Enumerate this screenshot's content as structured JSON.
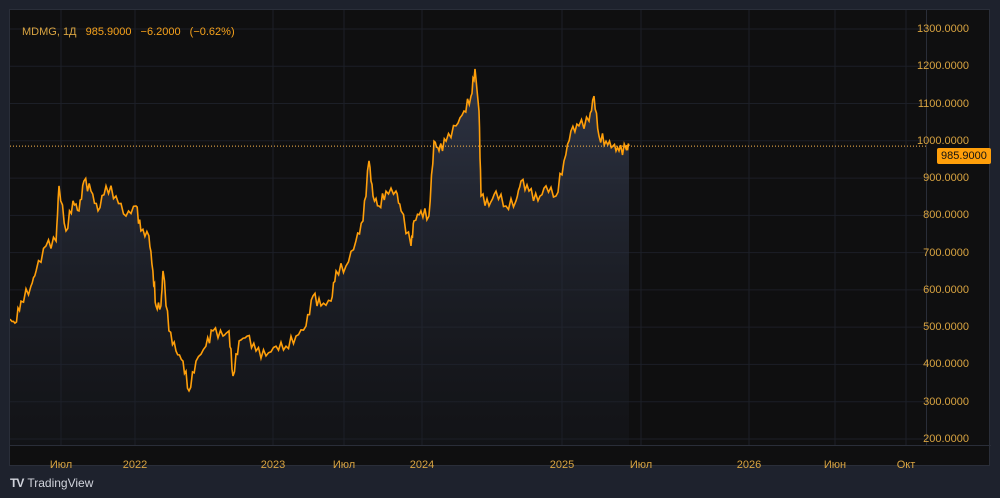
{
  "legend": {
    "symbol": "MDMG, 1Д",
    "price": "985.9000",
    "change": "−6.2000",
    "change_pct": "(−0.62%)"
  },
  "price_tag": "985.9000",
  "brand": "TradingView",
  "colors": {
    "line": "#ff9f0a",
    "text": "#d9a441"
  },
  "chart_data": {
    "type": "area",
    "title": "MDMG, 1Д",
    "ylim": [
      200,
      1300
    ],
    "y_ticks": [
      "1300.0000",
      "1200.0000",
      "1100.0000",
      "1000.0000",
      "900.0000",
      "800.0000",
      "700.0000",
      "600.0000",
      "500.0000",
      "400.0000",
      "300.0000",
      "200.0000"
    ],
    "x_ticks": [
      "Июл",
      "2022",
      "2023",
      "Июл",
      "2024",
      "2025",
      "Июл",
      "2026",
      "Июн",
      "Окт"
    ],
    "last_price": 985.9,
    "series": [
      {
        "name": "MDMG",
        "x": [
          2021.087,
          2021.13,
          2021.174,
          2021.246,
          2021.283,
          2021.355,
          2021.428,
          2021.449,
          2021.5,
          2021.551,
          2021.594,
          2021.63,
          2021.681,
          2021.732,
          2021.79,
          2021.862,
          2021.935,
          2022.007,
          2022.043,
          2022.101,
          2022.13,
          2022.152,
          2022.188,
          2022.203,
          2022.246,
          2022.297,
          2022.348,
          2022.391,
          2022.442,
          2022.514,
          2022.565,
          2022.638,
          2022.681,
          2022.71,
          2022.754,
          2022.812,
          2022.877,
          2022.949,
          2023.022,
          2023.094,
          2023.167,
          2023.239,
          2023.29,
          2023.348,
          2023.42,
          2023.457,
          2023.529,
          2023.601,
          2023.652,
          2023.696,
          2023.725,
          2023.768,
          2023.819,
          2023.891,
          2023.928,
          2024.0,
          2024.022,
          2024.072,
          2024.13,
          2024.167,
          2024.203,
          2024.254,
          2024.326,
          2024.384,
          2024.435,
          2024.464,
          2024.493,
          2024.507,
          2024.565,
          2024.616,
          2024.688,
          2024.761,
          2024.797,
          2024.855,
          2024.92,
          2024.978,
          2025.051,
          2025.109,
          2025.159,
          2025.217,
          2025.29,
          2025.326,
          2025.362,
          2025.413,
          2025.464,
          2025.507,
          2025.558,
          2025.58
        ],
        "values": [
          522,
          511,
          570,
          610,
          651,
          718,
          731,
          879,
          758,
          839,
          812,
          892,
          865,
          812,
          879,
          852,
          798,
          825,
          758,
          745,
          651,
          557,
          557,
          651,
          490,
          436,
          409,
          329,
          409,
          449,
          490,
          476,
          490,
          369,
          463,
          476,
          436,
          423,
          449,
          449,
          476,
          503,
          584,
          557,
          570,
          651,
          664,
          731,
          785,
          946,
          852,
          825,
          865,
          865,
          812,
          718,
          785,
          812,
          798,
          999,
          973,
          999,
          1040,
          1080,
          1120,
          1193,
          1080,
          852,
          825,
          865,
          825,
          839,
          892,
          865,
          839,
          879,
          852,
          946,
          1026,
          1040,
          1053,
          1120,
          1013,
          999,
          986,
          973,
          979,
          986
        ]
      }
    ]
  }
}
